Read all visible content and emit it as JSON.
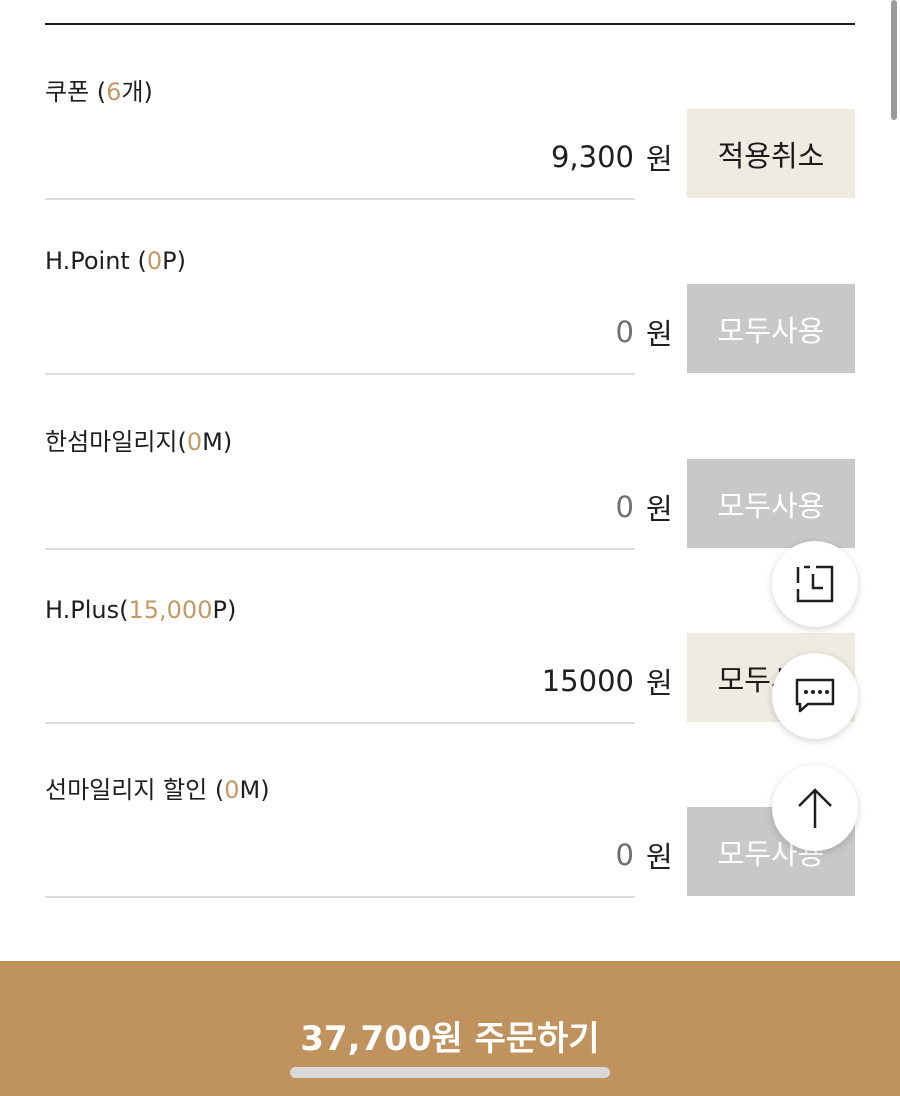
{
  "rows": [
    {
      "name": "쿠폰",
      "paren_open": " (",
      "highlight": "6",
      "suffix": "개)",
      "amount": "9,300",
      "unit": "원",
      "button": "적용취소"
    },
    {
      "name": "H.Point",
      "paren_open": " (",
      "highlight": "0",
      "suffix": "P)",
      "amount": "0",
      "unit": "원",
      "button": "모두사용"
    },
    {
      "name": "한섬마일리지",
      "paren_open": "(",
      "highlight": "0",
      "suffix": "M)",
      "amount": "0",
      "unit": "원",
      "button": "모두사용"
    },
    {
      "name": "H.Plus",
      "paren_open": "(",
      "highlight": "15,000",
      "suffix": "P)",
      "amount": "15000",
      "unit": "원",
      "button": "모두사용"
    },
    {
      "name": "선마일리지 할인",
      "paren_open": " (",
      "highlight": "0",
      "suffix": "M)",
      "amount": "0",
      "unit": "원",
      "button": "모두사용"
    }
  ],
  "order": {
    "label": "37,700원 주문하기"
  },
  "floating": {
    "icons": [
      "recent-view-icon",
      "chat-icon",
      "arrow-up-icon"
    ]
  },
  "colors": {
    "accent": "#c0935e",
    "highlight": "#c29a62",
    "active_button_bg": "#f0ebe0",
    "disabled_button_bg": "#c8c8c8"
  }
}
